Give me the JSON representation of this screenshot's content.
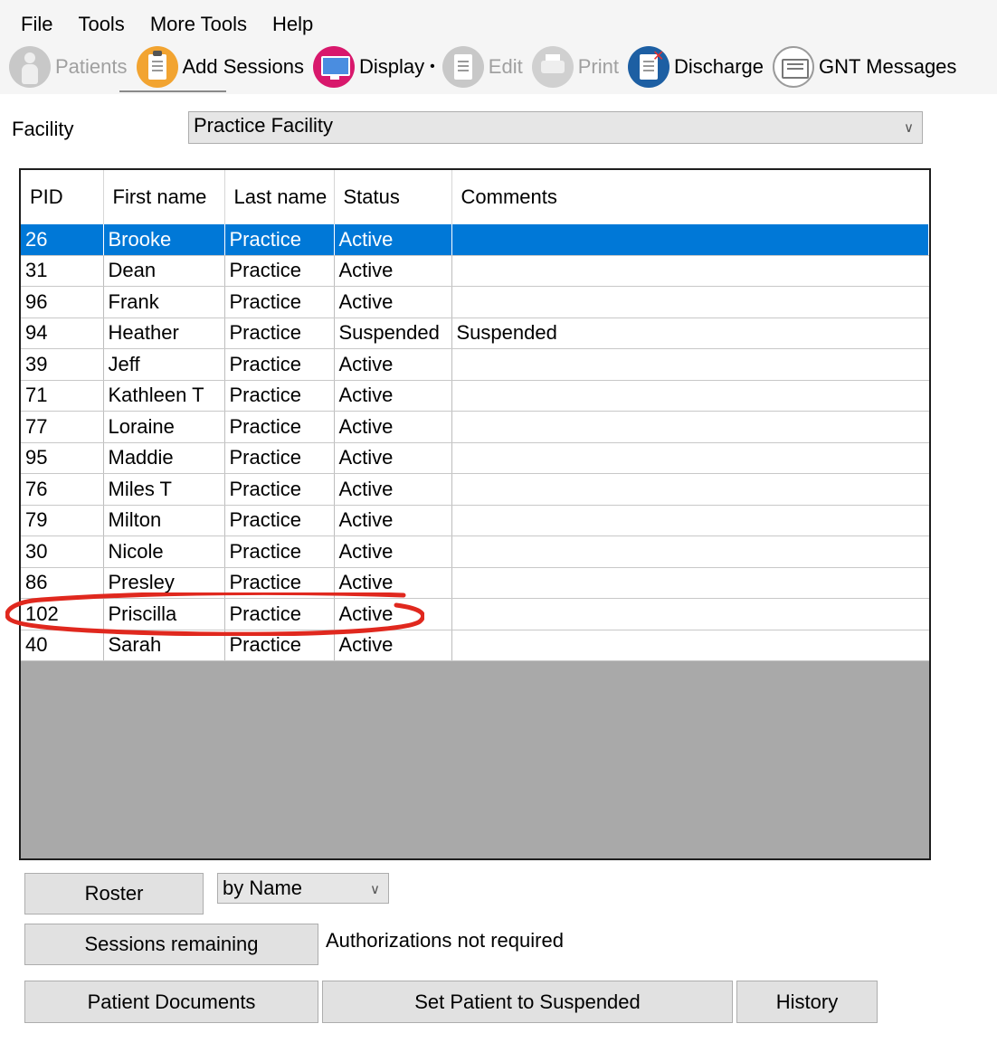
{
  "menu": [
    "File",
    "Tools",
    "More Tools",
    "Help"
  ],
  "toolbar": {
    "patients": "Patients",
    "add_sessions": "Add Sessions",
    "display": "Display",
    "edit": "Edit",
    "print": "Print",
    "discharge": "Discharge",
    "gnt_messages": "GNT Messages"
  },
  "facility": {
    "label": "Facility",
    "value": "Practice Facility"
  },
  "grid": {
    "headers": {
      "pid": "PID",
      "first": "First name",
      "last": "Last name",
      "status": "Status",
      "comments": "Comments"
    },
    "rows": [
      {
        "pid": "26",
        "first": "Brooke",
        "last": "Practice",
        "status": "Active",
        "comments": ""
      },
      {
        "pid": "31",
        "first": "Dean",
        "last": "Practice",
        "status": "Active",
        "comments": ""
      },
      {
        "pid": "96",
        "first": "Frank",
        "last": "Practice",
        "status": "Active",
        "comments": ""
      },
      {
        "pid": "94",
        "first": "Heather",
        "last": "Practice",
        "status": "Suspended",
        "comments": "Suspended"
      },
      {
        "pid": "39",
        "first": "Jeff",
        "last": "Practice",
        "status": "Active",
        "comments": ""
      },
      {
        "pid": "71",
        "first": "Kathleen T",
        "last": "Practice",
        "status": "Active",
        "comments": ""
      },
      {
        "pid": "77",
        "first": "Loraine",
        "last": "Practice",
        "status": "Active",
        "comments": ""
      },
      {
        "pid": "95",
        "first": "Maddie",
        "last": "Practice",
        "status": "Active",
        "comments": ""
      },
      {
        "pid": "76",
        "first": "Miles T",
        "last": "Practice",
        "status": "Active",
        "comments": ""
      },
      {
        "pid": "79",
        "first": "Milton",
        "last": "Practice",
        "status": "Active",
        "comments": ""
      },
      {
        "pid": "30",
        "first": "Nicole",
        "last": "Practice",
        "status": "Active",
        "comments": ""
      },
      {
        "pid": "86",
        "first": "Presley",
        "last": "Practice",
        "status": "Active",
        "comments": ""
      },
      {
        "pid": "102",
        "first": "Priscilla",
        "last": "Practice",
        "status": "Active",
        "comments": ""
      },
      {
        "pid": "40",
        "first": "Sarah",
        "last": "Practice",
        "status": "Active",
        "comments": ""
      }
    ]
  },
  "bottom": {
    "roster": "Roster",
    "sort_value": "by Name",
    "sessions_remaining": "Sessions remaining",
    "auth_text": "Authorizations not required",
    "patient_documents": "Patient Documents",
    "set_suspended": "Set Patient to Suspended",
    "history": "History"
  },
  "colors": {
    "selection": "#0078d7",
    "annotation": "#e0281e"
  }
}
